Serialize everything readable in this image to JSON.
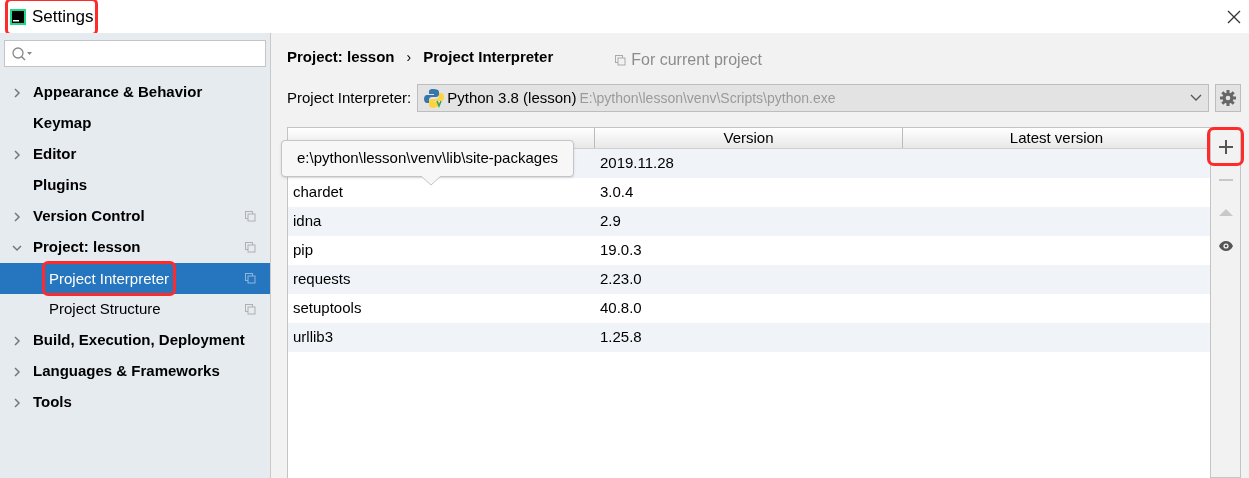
{
  "window": {
    "title": "Settings",
    "highlighted": true
  },
  "sidebar": {
    "items": [
      {
        "label": "Appearance & Behavior",
        "expanded": false,
        "project_level": false,
        "selected": false,
        "highlighted": false
      },
      {
        "label": "Keymap",
        "project_level": false,
        "selected": false,
        "highlighted": false
      },
      {
        "label": "Editor",
        "expanded": false,
        "project_level": false,
        "selected": false,
        "highlighted": false
      },
      {
        "label": "Plugins",
        "project_level": false,
        "selected": false,
        "highlighted": false
      },
      {
        "label": "Version Control",
        "expanded": false,
        "project_level": true,
        "selected": false,
        "highlighted": false
      },
      {
        "label": "Project: lesson",
        "expanded": true,
        "project_level": true,
        "selected": false,
        "highlighted": false,
        "children": [
          {
            "label": "Project Interpreter",
            "project_level": true,
            "selected": true,
            "highlighted": true
          },
          {
            "label": "Project Structure",
            "project_level": true,
            "selected": false,
            "highlighted": false
          }
        ]
      },
      {
        "label": "Build, Execution, Deployment",
        "expanded": false,
        "project_level": false,
        "selected": false,
        "highlighted": false
      },
      {
        "label": "Languages & Frameworks",
        "expanded": false,
        "project_level": false,
        "selected": false,
        "highlighted": false
      },
      {
        "label": "Tools",
        "expanded": false,
        "project_level": false,
        "selected": false,
        "highlighted": false
      }
    ]
  },
  "breadcrumb": {
    "items": [
      "Project: lesson",
      "Project Interpreter"
    ],
    "separator": "›"
  },
  "scope_note": "For current project",
  "interpreter": {
    "label": "Project Interpreter:",
    "name": "Python 3.8 (lesson)",
    "path": "E:\\python\\lesson\\venv\\Scripts\\python.exe"
  },
  "tooltip": "e:\\python\\lesson\\venv\\lib\\site-packages",
  "table": {
    "columns": [
      "Version",
      "Latest version"
    ],
    "rows": [
      {
        "version": "2019.11.28"
      },
      {
        "package": "chardet",
        "version": "3.0.4"
      },
      {
        "package": "idna",
        "version": "2.9"
      },
      {
        "package": "pip",
        "version": "19.0.3"
      },
      {
        "package": "requests",
        "version": "2.23.0"
      },
      {
        "package": "setuptools",
        "version": "40.8.0"
      },
      {
        "package": "urllib3",
        "version": "1.25.8"
      }
    ]
  },
  "toolbar": [
    {
      "kind": "add",
      "disabled": false,
      "highlighted": true
    },
    {
      "kind": "remove",
      "disabled": true,
      "highlighted": false
    },
    {
      "kind": "upgrade",
      "disabled": true,
      "highlighted": false
    },
    {
      "kind": "show",
      "disabled": false,
      "highlighted": false
    }
  ]
}
